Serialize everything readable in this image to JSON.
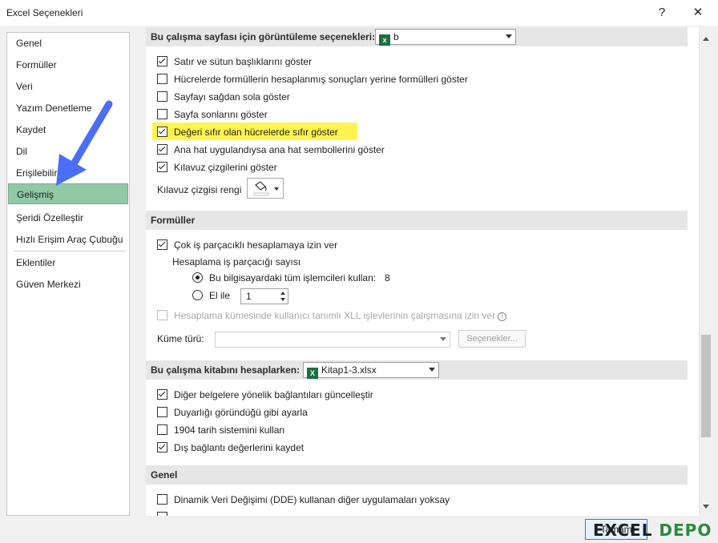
{
  "window": {
    "title": "Excel Seçenekleri",
    "help_glyph": "?",
    "close_glyph": "✕"
  },
  "sidebar": {
    "items": [
      {
        "label": "Genel"
      },
      {
        "label": "Formüller"
      },
      {
        "label": "Veri"
      },
      {
        "label": "Yazım Denetleme"
      },
      {
        "label": "Kaydet"
      },
      {
        "label": "Dil"
      },
      {
        "label": "Erişilebilirlik"
      },
      {
        "label": "Gelişmiş"
      },
      {
        "label": "Şeridi Özelleştir"
      },
      {
        "label": "Hızlı Erişim Araç Çubuğu"
      },
      {
        "label": "Eklentiler"
      },
      {
        "label": "Güven Merkezi"
      }
    ],
    "selected": "Gelişmiş"
  },
  "display_section": {
    "header": "Bu çalışma sayfası için görüntüleme seçenekleri:",
    "sheet_value": "b",
    "options": [
      {
        "label": "Satır ve sütun başlıklarını göster",
        "checked": true
      },
      {
        "label": "Hücrelerde formüllerin hesaplanmış sonuçları yerine formülleri göster",
        "checked": false
      },
      {
        "label": "Sayfayı sağdan sola göster",
        "checked": false
      },
      {
        "label": "Sayfa sonlarını göster",
        "checked": false
      },
      {
        "label": "Değeri sıfır olan hücrelerde sıfır göster",
        "checked": true,
        "highlighted": true
      },
      {
        "label": "Ana hat uygulandıysa ana hat sembollerini göster",
        "checked": true
      },
      {
        "label": "Kılavuz çizgilerini göster",
        "checked": true
      }
    ],
    "gridline_color_label": "Kılavuz çizgisi rengi"
  },
  "formulas_section": {
    "header": "Formüller",
    "multithread_label": "Çok iş parçacıklı hesaplamaya izin ver",
    "thread_count_label": "Hesaplama iş parçacığı sayısı",
    "all_processors_label": "Bu bilgisayardaki tüm işlemcileri kullan:",
    "processor_count": "8",
    "manual_label": "El ile",
    "manual_value": "1",
    "xll_label": "Hesaplama kümesinde kullanıcı tanımlı XLL işlevlerinin çalışmasına izin ver",
    "cluster_type_label": "Küme türü:",
    "options_button": "Seçenekler..."
  },
  "workbook_section": {
    "header": "Bu çalışma kitabını hesaplarken:",
    "workbook_value": "Kitap1-3.xlsx",
    "options": [
      {
        "label": "Diğer belgelere yönelik bağlantıları güncelleştir",
        "checked": true
      },
      {
        "label": "Duyarlığı göründüğü gibi ayarla",
        "checked": false
      },
      {
        "label": "1904 tarih sistemini kullan",
        "checked": false
      },
      {
        "label": "Dış bağlantı değerlerini kaydet",
        "checked": true
      }
    ]
  },
  "general_section": {
    "header": "Genel",
    "dde_label": "Dinamik Veri Değişimi (DDE) kullanan diğer uygulamaları yoksay"
  },
  "footer": {
    "ok_label": "Tamam"
  },
  "colors": {
    "highlight": "#fff44f",
    "selected_nav": "#91c9a7",
    "arrow": "#4a6ef5"
  }
}
